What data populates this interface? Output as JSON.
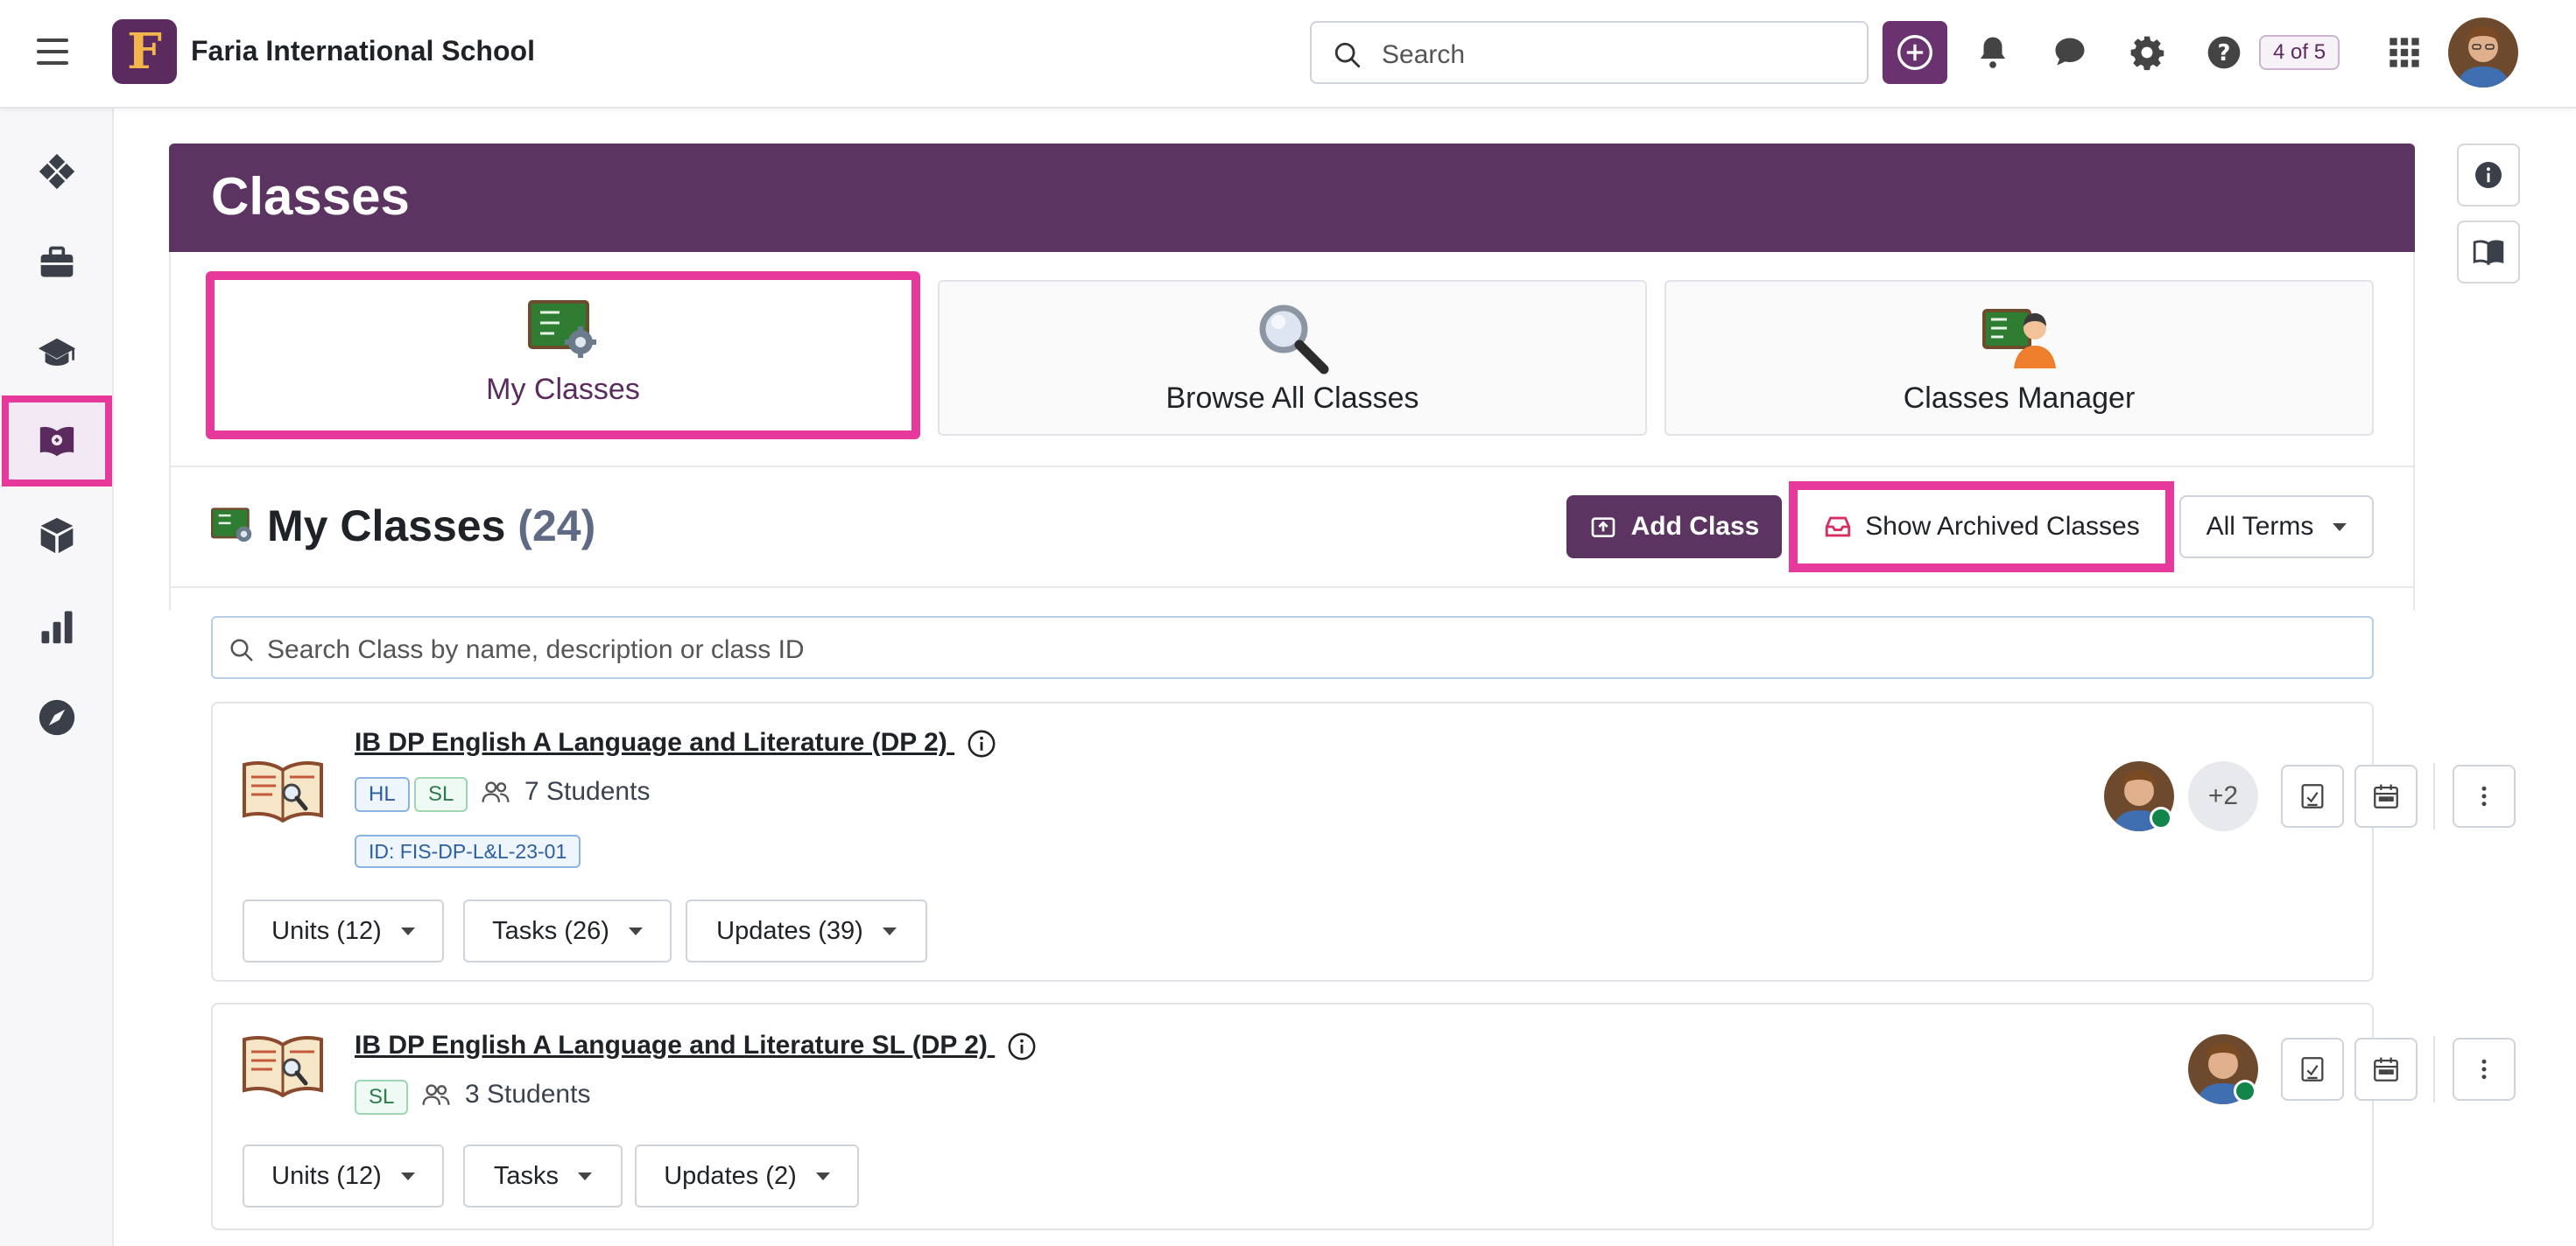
{
  "topbar": {
    "logo_letter": "F",
    "school_name": "Faria International School",
    "search_placeholder": "Search",
    "help_counter": "4 of 5"
  },
  "header": {
    "title": "Classes"
  },
  "nav_cards": [
    {
      "label": "My Classes",
      "icon": "my-classes-board-icon",
      "highlighted": true
    },
    {
      "label": "Browse All Classes",
      "icon": "magnifier-icon"
    },
    {
      "label": "Classes Manager",
      "icon": "classes-manager-icon"
    }
  ],
  "my_classes": {
    "title": "My Classes",
    "count": "(24)",
    "add_class_label": "Add Class",
    "show_archived_label": "Show Archived Classes",
    "terms_label": "All Terms",
    "search_placeholder": "Search Class by name, description or class ID"
  },
  "classes": [
    {
      "title": "IB DP English A Language and Literature (DP 2)",
      "tags": [
        "HL",
        "SL"
      ],
      "students": "7 Students",
      "class_id": "ID: FIS-DP-L&L-23-01",
      "extra_teachers": "+2",
      "units": "Units (12)",
      "tasks": "Tasks (26)",
      "updates": "Updates (39)"
    },
    {
      "title": "IB DP English A Language and Literature SL (DP 2)",
      "tags": [
        "SL"
      ],
      "students": "3 Students",
      "units": "Units (12)",
      "tasks": "Tasks",
      "updates": "Updates (2)"
    }
  ],
  "colors": {
    "brand_purple": "#5c3461",
    "highlight_pink": "#e6399b",
    "online_green": "#12864a"
  }
}
